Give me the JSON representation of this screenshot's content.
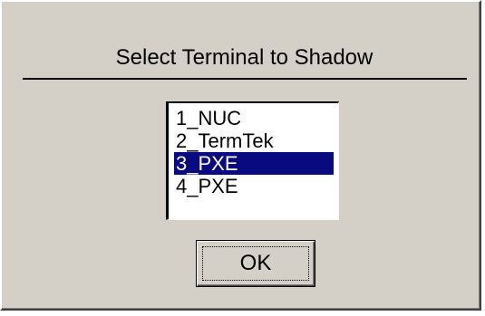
{
  "dialog": {
    "title": "Select Terminal to Shadow",
    "terminals": [
      {
        "label": "1_NUC",
        "selected": false
      },
      {
        "label": "2_TermTek",
        "selected": false
      },
      {
        "label": "3_PXE",
        "selected": true
      },
      {
        "label": "4_PXE",
        "selected": false
      }
    ],
    "ok_label": "OK"
  },
  "colors": {
    "face": "#d4d0c8",
    "selection": "#0a0a80"
  }
}
